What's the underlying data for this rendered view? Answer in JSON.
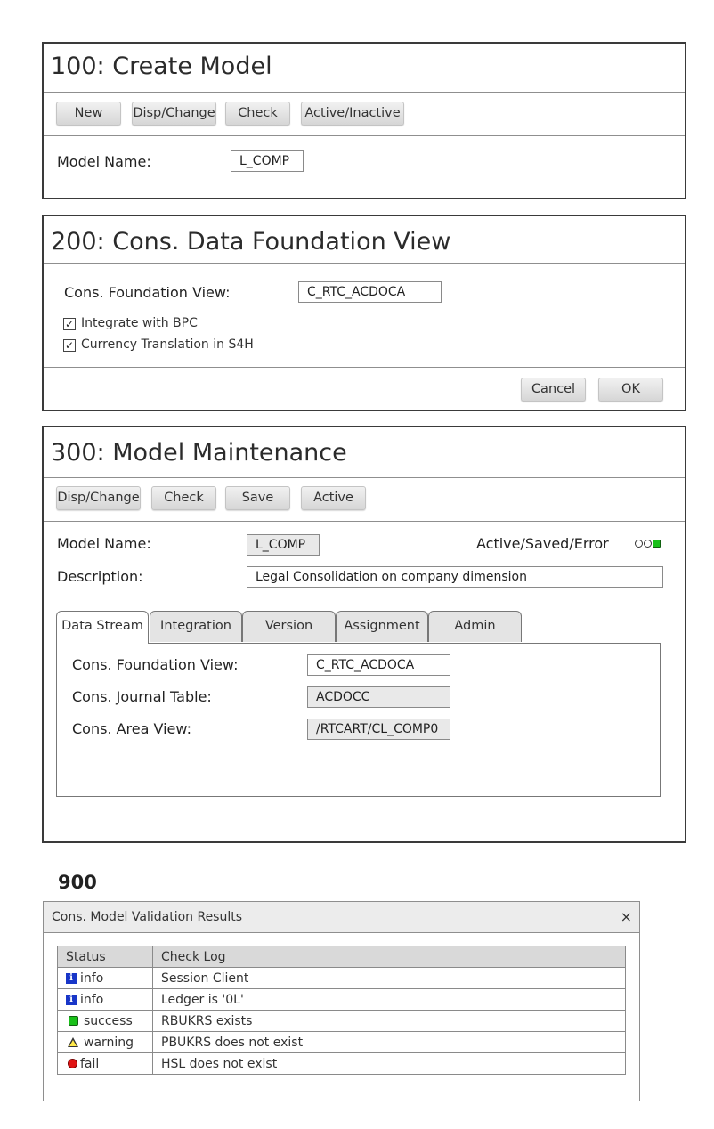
{
  "panel_100": {
    "title": "100: Create Model",
    "buttons": [
      "New",
      "Disp/Change",
      "Check",
      "Active/Inactive"
    ],
    "model_name_label": "Model Name:",
    "model_name_value": "L_COMP"
  },
  "panel_200": {
    "title": "200: Cons. Data Foundation View",
    "foundation_view_label": "Cons. Foundation View:",
    "foundation_view_value": "C_RTC_ACDOCA",
    "checkboxes": [
      {
        "label": "Integrate with BPC",
        "checked": true
      },
      {
        "label": "Currency Translation in S4H",
        "checked": true
      }
    ],
    "cancel_label": "Cancel",
    "ok_label": "OK"
  },
  "panel_300": {
    "title": "300: Model Maintenance",
    "buttons": [
      "Disp/Change",
      "Check",
      "Save",
      "Active"
    ],
    "model_name_label": "Model Name:",
    "model_name_value": "L_COMP",
    "status_label": "Active/Saved/Error",
    "status_indicator": "active",
    "status_color": "#19c019",
    "description_label": "Description:",
    "description_value": "Legal Consolidation on company dimension",
    "tabs": [
      "Data Stream",
      "Integration",
      "Version",
      "Assignment",
      "Admin"
    ],
    "active_tab": "Data Stream",
    "fields": [
      {
        "label": "Cons. Foundation View:",
        "value": "C_RTC_ACDOCA",
        "readonly": false
      },
      {
        "label": "Cons. Journal Table:",
        "value": "ACDOCC",
        "readonly": true
      },
      {
        "label": "Cons. Area View:",
        "value": "/RTCART/CL_COMP0",
        "readonly": true
      }
    ]
  },
  "section_900": {
    "heading": "900",
    "dialog_title": "Cons. Model Validation Results",
    "close_icon": "×",
    "columns": [
      "Status",
      "Check Log"
    ],
    "rows": [
      {
        "icon": "info-icon",
        "status": "info",
        "log": "Session Client"
      },
      {
        "icon": "info-icon",
        "status": "info",
        "log": "Ledger is '0L'"
      },
      {
        "icon": "success-icon",
        "status": "success",
        "log": "RBUKRS exists"
      },
      {
        "icon": "warning-icon",
        "status": "warning",
        "log": "PBUKRS does not exist"
      },
      {
        "icon": "fail-icon",
        "status": "fail",
        "log": "HSL does not exist"
      }
    ]
  }
}
